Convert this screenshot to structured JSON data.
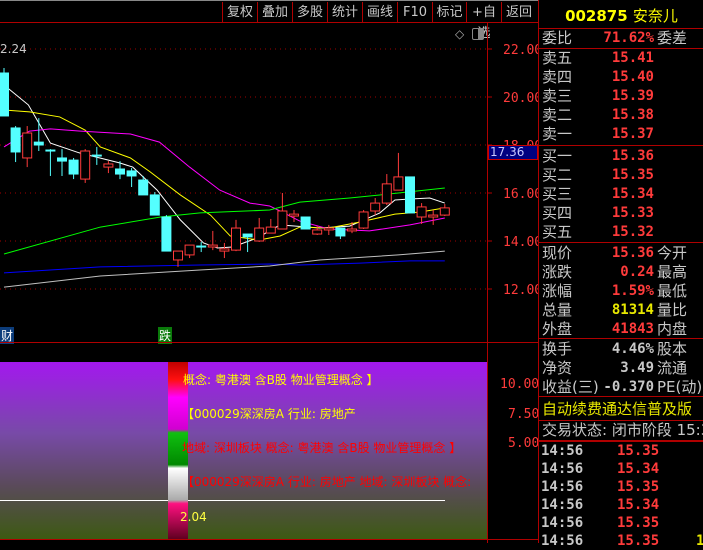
{
  "toolbar": {
    "buttons": [
      "复权",
      "叠加",
      "多股",
      "统计",
      "画线",
      "F10",
      "标记",
      "+自选",
      "返回"
    ]
  },
  "chart": {
    "top_left_label": "2.24",
    "price_marker": "17.36",
    "badge_cai": "财",
    "badge_die": "跌",
    "icons": [
      "diamond-icon",
      "panel-toggle-icon"
    ]
  },
  "chart_data": {
    "type": "candlestick",
    "y_ticks": [
      "22.00",
      "20.00",
      "18.00",
      "16.00",
      "14.00",
      "12.00"
    ],
    "ylim": [
      11.5,
      23
    ],
    "up_color": "#ff3b3b",
    "down_color": "#54ffff",
    "ohlc": [
      [
        21.0,
        21.21,
        19.21,
        19.21
      ],
      [
        18.71,
        18.79,
        17.29,
        17.71
      ],
      [
        17.46,
        18.79,
        17.08,
        18.5
      ],
      [
        18.12,
        19.12,
        17.75,
        18.0
      ],
      [
        17.79,
        17.83,
        16.71,
        17.77
      ],
      [
        17.46,
        17.83,
        16.71,
        17.33
      ],
      [
        17.37,
        17.46,
        16.58,
        16.79
      ],
      [
        16.58,
        17.83,
        16.42,
        17.75
      ],
      [
        17.58,
        17.92,
        17.17,
        17.56
      ],
      [
        17.08,
        17.33,
        16.83,
        17.21
      ],
      [
        17.0,
        17.33,
        16.58,
        16.79
      ],
      [
        16.92,
        17.04,
        16.25,
        16.71
      ],
      [
        16.54,
        16.71,
        15.92,
        15.92
      ],
      [
        15.92,
        16.04,
        15.08,
        15.08
      ],
      [
        15.0,
        15.08,
        13.58,
        13.58
      ],
      [
        13.21,
        13.58,
        12.92,
        13.58
      ],
      [
        13.42,
        13.83,
        13.29,
        13.83
      ],
      [
        13.79,
        13.96,
        13.54,
        13.77
      ],
      [
        13.75,
        14.42,
        13.62,
        13.83
      ],
      [
        13.58,
        13.92,
        13.29,
        13.67
      ],
      [
        13.62,
        14.88,
        13.58,
        14.54
      ],
      [
        14.29,
        14.29,
        13.54,
        14.17
      ],
      [
        14.0,
        14.96,
        13.96,
        14.54
      ],
      [
        14.33,
        14.92,
        14.33,
        14.58
      ],
      [
        14.5,
        16.0,
        14.5,
        15.25
      ],
      [
        15.04,
        15.29,
        14.79,
        15.12
      ],
      [
        15.0,
        15.0,
        14.5,
        14.5
      ],
      [
        14.29,
        14.62,
        14.25,
        14.46
      ],
      [
        14.46,
        14.67,
        14.25,
        14.54
      ],
      [
        14.54,
        14.54,
        14.08,
        14.21
      ],
      [
        14.42,
        14.79,
        14.33,
        14.5
      ],
      [
        14.54,
        15.29,
        14.5,
        15.21
      ],
      [
        15.25,
        15.79,
        15.08,
        15.58
      ],
      [
        15.58,
        16.79,
        15.5,
        16.38
      ],
      [
        16.12,
        17.67,
        16.12,
        16.67
      ],
      [
        16.67,
        16.67,
        15.17,
        15.17
      ],
      [
        15.0,
        15.58,
        14.71,
        15.42
      ],
      [
        15.0,
        15.29,
        14.67,
        15.08
      ],
      [
        15.08,
        15.54,
        15.04,
        15.38
      ]
    ],
    "ma_lines": [
      {
        "color": "#ffffff",
        "points": [
          [
            0,
            20.5
          ],
          [
            2.1,
            19.67
          ],
          [
            4,
            18.08
          ],
          [
            6.5,
            17.67
          ],
          [
            10,
            17.25
          ],
          [
            11.1,
            17.08
          ],
          [
            13.2,
            16.12
          ],
          [
            15.2,
            14.88
          ],
          [
            17.2,
            13.92
          ],
          [
            18.4,
            13.71
          ],
          [
            19.7,
            13.75
          ],
          [
            21.8,
            14.12
          ],
          [
            23.8,
            14.67
          ],
          [
            27.2,
            14.54
          ],
          [
            29.8,
            14.62
          ],
          [
            32.4,
            15.17
          ],
          [
            33.7,
            15.71
          ],
          [
            35,
            15.75
          ],
          [
            36.7,
            15.79
          ],
          [
            38,
            15.58
          ]
        ]
      },
      {
        "color": "#ffff00",
        "points": [
          [
            0,
            19.46
          ],
          [
            2.2,
            19.38
          ],
          [
            4.8,
            19.17
          ],
          [
            7,
            18.62
          ],
          [
            8.3,
            17.92
          ],
          [
            10.9,
            17.46
          ],
          [
            12.6,
            16.88
          ],
          [
            15.2,
            15.92
          ],
          [
            17.8,
            15.08
          ],
          [
            19.5,
            14.21
          ],
          [
            22,
            14.04
          ],
          [
            23.8,
            14.21
          ],
          [
            25.5,
            14.58
          ],
          [
            28,
            14.54
          ],
          [
            30.7,
            14.79
          ],
          [
            33.7,
            15.12
          ],
          [
            35.9,
            15.21
          ],
          [
            38,
            15.38
          ]
        ]
      },
      {
        "color": "#ff00ff",
        "points": [
          [
            0,
            17.92
          ],
          [
            2.2,
            18.58
          ],
          [
            4,
            18.67
          ],
          [
            6.6,
            18.58
          ],
          [
            10.9,
            18.46
          ],
          [
            13.4,
            18.12
          ],
          [
            16,
            17.08
          ],
          [
            18.6,
            16.12
          ],
          [
            21.2,
            15.58
          ],
          [
            22.9,
            15.46
          ],
          [
            23.8,
            15.25
          ],
          [
            25.5,
            14.83
          ],
          [
            28,
            14.5
          ],
          [
            31.5,
            14.42
          ],
          [
            35,
            14.67
          ],
          [
            38,
            14.96
          ]
        ]
      },
      {
        "color": "#00ff00",
        "points": [
          [
            0,
            13.46
          ],
          [
            8.3,
            14.58
          ],
          [
            13.5,
            15.0
          ],
          [
            16.9,
            15.17
          ],
          [
            22.9,
            15.29
          ],
          [
            25.5,
            15.62
          ],
          [
            29.8,
            15.79
          ],
          [
            34,
            16.0
          ],
          [
            38,
            16.21
          ]
        ]
      },
      {
        "color": "#0000ff",
        "points": [
          [
            0,
            12.67
          ],
          [
            8.3,
            12.92
          ],
          [
            16.9,
            13.0
          ],
          [
            22.9,
            13.04
          ],
          [
            25.5,
            13.0
          ],
          [
            30.7,
            13.08
          ],
          [
            35,
            13.17
          ],
          [
            38,
            13.17
          ]
        ]
      },
      {
        "color": "#c0c0c0",
        "points": [
          [
            0,
            12.08
          ],
          [
            8.3,
            12.54
          ],
          [
            16.9,
            12.79
          ],
          [
            22.9,
            12.96
          ],
          [
            27.2,
            13.21
          ],
          [
            34,
            13.42
          ],
          [
            38,
            13.58
          ]
        ]
      }
    ]
  },
  "lower": {
    "y_ticks": [
      "10.00",
      "7.50",
      "5.00"
    ],
    "value": "2.04",
    "lines": [
      {
        "text": "概念: 粤港澳 含B股 物业管理概念 】",
        "color": "#ffff00"
      },
      {
        "text": "【000029深深房A 行业: 房地产",
        "color": "#ffff00"
      },
      {
        "text": "地域: 深圳板块 概念: 粤港澳 含B股 物业管理概念 】",
        "color": "#ff0000"
      },
      {
        "text": "【000029深深房A 行业: 房地产 地域: 深圳板块 概念:",
        "color": "#ff0000"
      }
    ]
  },
  "quote": {
    "code": "002875",
    "name": "安奈儿",
    "wei_bi_label": "委比",
    "wei_bi": "71.62%",
    "wei_cha_label": "委差",
    "sells": [
      {
        "label": "卖五",
        "price": "15.41"
      },
      {
        "label": "卖四",
        "price": "15.40"
      },
      {
        "label": "卖三",
        "price": "15.39"
      },
      {
        "label": "卖二",
        "price": "15.38"
      },
      {
        "label": "卖一",
        "price": "15.37"
      }
    ],
    "buys": [
      {
        "label": "买一",
        "price": "15.36"
      },
      {
        "label": "买二",
        "price": "15.35"
      },
      {
        "label": "买三",
        "price": "15.34"
      },
      {
        "label": "买四",
        "price": "15.33"
      },
      {
        "label": "买五",
        "price": "15.32"
      }
    ],
    "stats": [
      {
        "label": "现价",
        "value": "15.36",
        "label2": "今开",
        "color": "red"
      },
      {
        "label": "涨跌",
        "value": "0.24",
        "label2": "最高",
        "color": "red"
      },
      {
        "label": "涨幅",
        "value": "1.59%",
        "label2": "最低",
        "color": "red"
      },
      {
        "label": "总量",
        "value": "81314",
        "label2": "量比",
        "color": "yel"
      },
      {
        "label": "外盘",
        "value": "41843",
        "label2": "内盘",
        "color": "red"
      }
    ],
    "stats2": [
      {
        "label": "换手",
        "value": "4.46%",
        "label2": "股本"
      },
      {
        "label": "净资",
        "value": "3.49",
        "label2": "流通"
      },
      {
        "label": "收益(三)",
        "value": "-0.370",
        "label2": "PE(动)"
      }
    ],
    "promo": "自动续费通达信普及版",
    "status": "交易状态: 闭市阶段 15:3",
    "ticks": [
      {
        "time": "14:56",
        "price": "15.35"
      },
      {
        "time": "14:56",
        "price": "15.34"
      },
      {
        "time": "14:56",
        "price": "15.35"
      },
      {
        "time": "14:56",
        "price": "15.34"
      },
      {
        "time": "14:56",
        "price": "15.35"
      },
      {
        "time": "14:56",
        "price": "15.35",
        "extra": "1"
      }
    ]
  }
}
